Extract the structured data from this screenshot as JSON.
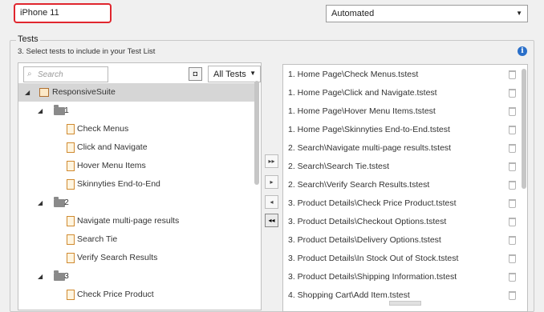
{
  "header": {
    "name_value": "iPhone 11",
    "type_value": "Automated"
  },
  "tests": {
    "title": "Tests",
    "subtitle": "3.  Select tests to include in your Test List",
    "search_placeholder": "Search",
    "filter_label": "All Tests",
    "tree": [
      {
        "label": "ResponsiveSuite",
        "kind": "suite",
        "level": 0,
        "selected": true
      },
      {
        "label": "1",
        "kind": "folder",
        "level": 1
      },
      {
        "label": "Check Menus",
        "kind": "test",
        "level": 2
      },
      {
        "label": "Click and Navigate",
        "kind": "test",
        "level": 2
      },
      {
        "label": "Hover Menu Items",
        "kind": "test",
        "level": 2
      },
      {
        "label": "Skinnyties End-to-End",
        "kind": "test",
        "level": 2
      },
      {
        "label": "2",
        "kind": "folder",
        "level": 1
      },
      {
        "label": "Navigate multi-page results",
        "kind": "test",
        "level": 2
      },
      {
        "label": "Search Tie",
        "kind": "test",
        "level": 2
      },
      {
        "label": "Verify Search Results",
        "kind": "test",
        "level": 2
      },
      {
        "label": "3",
        "kind": "folder",
        "level": 1
      },
      {
        "label": "Check Price Product",
        "kind": "test",
        "level": 2
      }
    ],
    "selected": [
      "1. Home Page\\Check Menus.tstest",
      "1. Home Page\\Click and Navigate.tstest",
      "1. Home Page\\Hover Menu Items.tstest",
      "1. Home Page\\Skinnyties End-to-End.tstest",
      "2. Search\\Navigate multi-page results.tstest",
      "2. Search\\Search Tie.tstest",
      "2. Search\\Verify Search Results.tstest",
      "3. Product Details\\Check Price Product.tstest",
      "3. Product Details\\Checkout Options.tstest",
      "3. Product Details\\Delivery Options.tstest",
      "3. Product Details\\In Stock Out of Stock.tstest",
      "3. Product Details\\Shipping Information.tstest",
      "4. Shopping Cart\\Add Item.tstest"
    ]
  }
}
